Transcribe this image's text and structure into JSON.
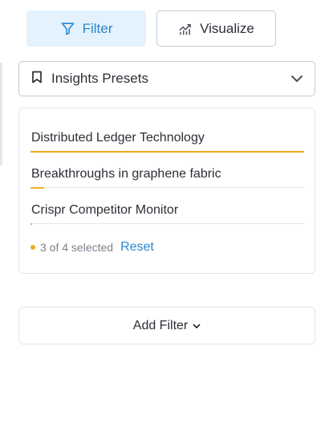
{
  "toolbar": {
    "filter_label": "Filter",
    "visualize_label": "Visualize"
  },
  "presets": {
    "label": "Insights Presets"
  },
  "filter_list": {
    "items": [
      {
        "label": "Distributed Ledger Technology",
        "progress": 1.0
      },
      {
        "label": "Breakthroughs in graphene fabric",
        "progress": 0.05
      },
      {
        "label": "Crispr Competitor Monitor",
        "progress": 0.005
      }
    ],
    "status": {
      "selected_text": "3 of 4 selected",
      "reset_label": "Reset"
    }
  },
  "add_filter": {
    "label": "Add Filter"
  },
  "colors": {
    "accent_blue": "#2a86d1",
    "filter_bg": "#e3f2fc",
    "progress_orange": "#f0ac1a",
    "border": "#c5cad1"
  },
  "icons": {
    "filter": "funnel-icon",
    "visualize": "chart-icon",
    "presets": "bookmark-icon",
    "dropdown": "chevron-down-icon"
  }
}
